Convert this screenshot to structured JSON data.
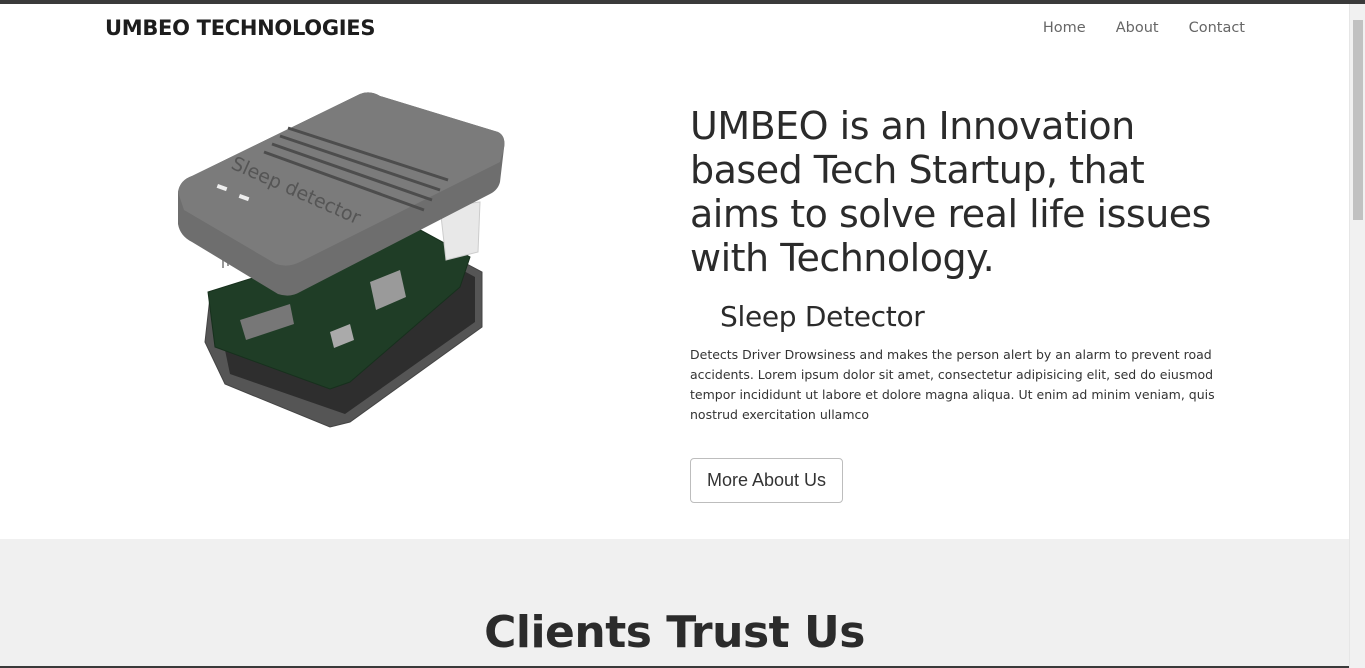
{
  "navbar": {
    "brand": "UMBEO TECHNOLOGIES",
    "links": [
      "Home",
      "About",
      "Contact"
    ]
  },
  "hero": {
    "headline": "UMBEO is an Innovation based Tech Startup, that aims to solve real life issues with Technology.",
    "product_title": "Sleep Detector",
    "device_label": "Sleep detector",
    "description": "Detects Driver Drowsiness and makes the person alert by an alarm to prevent road accidents. Lorem ipsum dolor sit amet, consectetur adipisicing elit, sed do eiusmod tempor incididunt ut labore et dolore magna aliqua. Ut enim ad minim veniam, quis nostrud exercitation ullamco",
    "button_label": "More About Us"
  },
  "clients": {
    "title": "Clients Trust Us"
  },
  "colors": {
    "text_dark": "#2b2b2b",
    "nav_link": "#666666",
    "section_bg": "#f0f0f0",
    "device_gray": "#6b6b6b",
    "pcb_green": "#1f3d26"
  }
}
